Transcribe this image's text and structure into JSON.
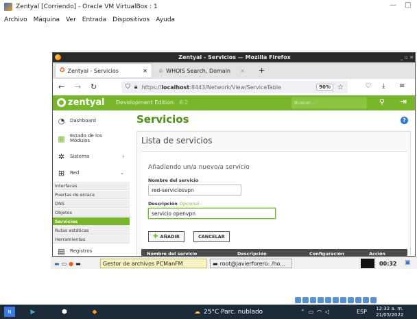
{
  "vbox": {
    "title": "Zentyal [Corriendo] - Oracle VM VirtualBox : 1",
    "menu": [
      "Archivo",
      "Máquina",
      "Ver",
      "Entrada",
      "Dispositivos",
      "Ayuda"
    ]
  },
  "firefox": {
    "title": "Zentyal - Servicios — Mozilla Firefox",
    "tabs": [
      {
        "label": "Zentyal - Servicios"
      },
      {
        "label": "WHOIS Search, Domain"
      }
    ],
    "url_prefix": "https://",
    "url_host": "localhost",
    "url_rest": ":8443/Network/View/ServiceTable",
    "zoom": "90%"
  },
  "zentyal": {
    "brand": "zentyal",
    "edition": "Development Edition",
    "version": "6.2",
    "search_placeholder": "Buscar...",
    "sidebar": {
      "dashboard": "Dashboard",
      "estado": "Estado de los Módulos",
      "sistema": "Sistema",
      "red": "Red",
      "red_items": [
        "Interfaces",
        "Puertas de enlace",
        "DNS",
        "Objetos",
        "Servicios",
        "Rutas estáticas",
        "Herramientas"
      ],
      "registros": "Registros"
    },
    "page_title": "Servicios",
    "panel_title": "Lista de servicios",
    "form": {
      "title": "Añadiendo un/a nuevo/a servicio",
      "name_label": "Nombre del servicio",
      "name_value": "red-serviciosvpn",
      "desc_label": "Descripción",
      "desc_optional": "Opcional",
      "desc_value": "servicio openvpn",
      "add_button": "AÑADIR",
      "cancel_button": "CANCELAR"
    },
    "table_headers": [
      "Nombre del servicio",
      "Descripción",
      "Configuración",
      "Acción"
    ]
  },
  "guest_taskbar": {
    "filemanager": "Gestor de archivos PCManFM",
    "terminal": "root@javierforero: /ho...",
    "clock": "00:32"
  },
  "windows_taskbar": {
    "weather": "25°C Parc. nublado",
    "lang": "ESP",
    "time": "12:32 a. m.",
    "date": "21/05/2022"
  },
  "colors": {
    "zentyal_green": "#78b62c",
    "taskbar": "#1c2a3a"
  }
}
